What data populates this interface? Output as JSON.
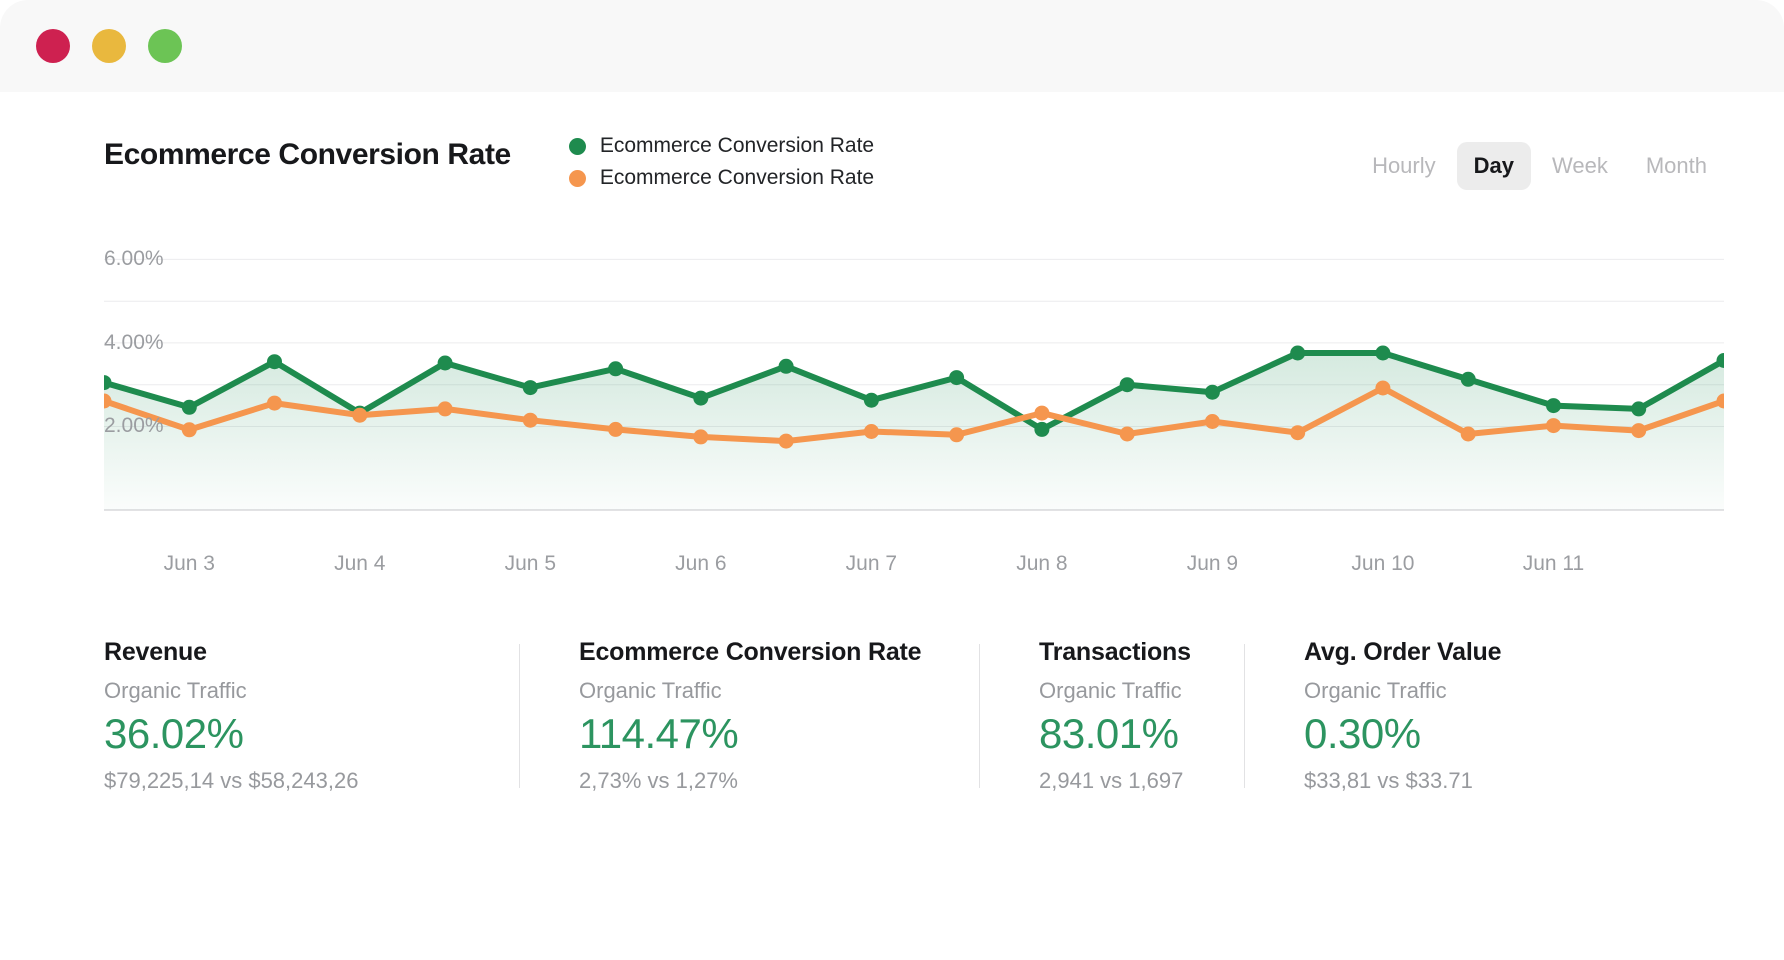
{
  "window": {
    "traffic_lights": [
      {
        "name": "close",
        "color": "#CE2150"
      },
      {
        "name": "minimize",
        "color": "#E9B83E"
      },
      {
        "name": "maximize",
        "color": "#6CC455"
      }
    ]
  },
  "header": {
    "title": "Ecommerce Conversion Rate",
    "legend": [
      {
        "label": "Ecommerce Conversion Rate",
        "color": "#1E8B4E"
      },
      {
        "label": "Ecommerce Conversion Rate",
        "color": "#F5964E"
      }
    ],
    "range_options": [
      {
        "label": "Hourly",
        "active": false
      },
      {
        "label": "Day",
        "active": true
      },
      {
        "label": "Week",
        "active": false
      },
      {
        "label": "Month",
        "active": false
      }
    ]
  },
  "chart_data": {
    "type": "line",
    "title": "Ecommerce Conversion Rate",
    "xlabel": "",
    "ylabel": "",
    "ylim": [
      0,
      6.8
    ],
    "ytick_values": [
      2,
      4,
      6
    ],
    "ytick_labels": [
      "2.00%",
      "4.00%",
      "6.00%"
    ],
    "grid": true,
    "legend_position": "top",
    "x_tick_labels": [
      "Jun 3",
      "Jun 4",
      "Jun 5",
      "Jun 6",
      "Jun 7",
      "Jun 8",
      "Jun 9",
      "Jun 10",
      "Jun 11"
    ],
    "x_tick_indices": [
      1,
      3,
      5,
      7,
      9,
      11,
      13,
      15,
      17
    ],
    "x": [
      0,
      1,
      2,
      3,
      4,
      5,
      6,
      7,
      8,
      9,
      10,
      11,
      12,
      13,
      14,
      15,
      16,
      17,
      18,
      19
    ],
    "series": [
      {
        "name": "Ecommerce Conversion Rate",
        "color": "#1E8B4E",
        "fill": true,
        "values": [
          3.05,
          2.46,
          3.55,
          2.32,
          3.52,
          2.93,
          3.38,
          2.68,
          3.44,
          2.63,
          3.17,
          1.93,
          3.0,
          2.82,
          3.76,
          3.76,
          3.13,
          2.5,
          2.42,
          3.58
        ]
      },
      {
        "name": "Ecommerce Conversion Rate",
        "color": "#F5964E",
        "fill": false,
        "values": [
          2.61,
          1.92,
          2.56,
          2.27,
          2.42,
          2.15,
          1.93,
          1.75,
          1.65,
          1.88,
          1.8,
          2.32,
          1.82,
          2.12,
          1.85,
          2.92,
          1.82,
          2.02,
          1.9,
          2.61
        ]
      }
    ]
  },
  "stats": [
    {
      "title": "Revenue",
      "subtitle": "Organic Traffic",
      "value": "36.02%",
      "compare": "$79,225,14 vs $58,243,26",
      "value_color": "#2c9460"
    },
    {
      "title": "Ecommerce Conversion Rate",
      "subtitle": "Organic Traffic",
      "value": "114.47%",
      "compare": "2,73% vs 1,27%",
      "value_color": "#2c9460"
    },
    {
      "title": "Transactions",
      "subtitle": "Organic Traffic",
      "value": "83.01%",
      "compare": "2,941 vs 1,697",
      "value_color": "#2c9460"
    },
    {
      "title": "Avg. Order Value",
      "subtitle": "Organic Traffic",
      "value": "0.30%",
      "compare": "$33,81 vs $33.71",
      "value_color": "#2c9460"
    }
  ]
}
